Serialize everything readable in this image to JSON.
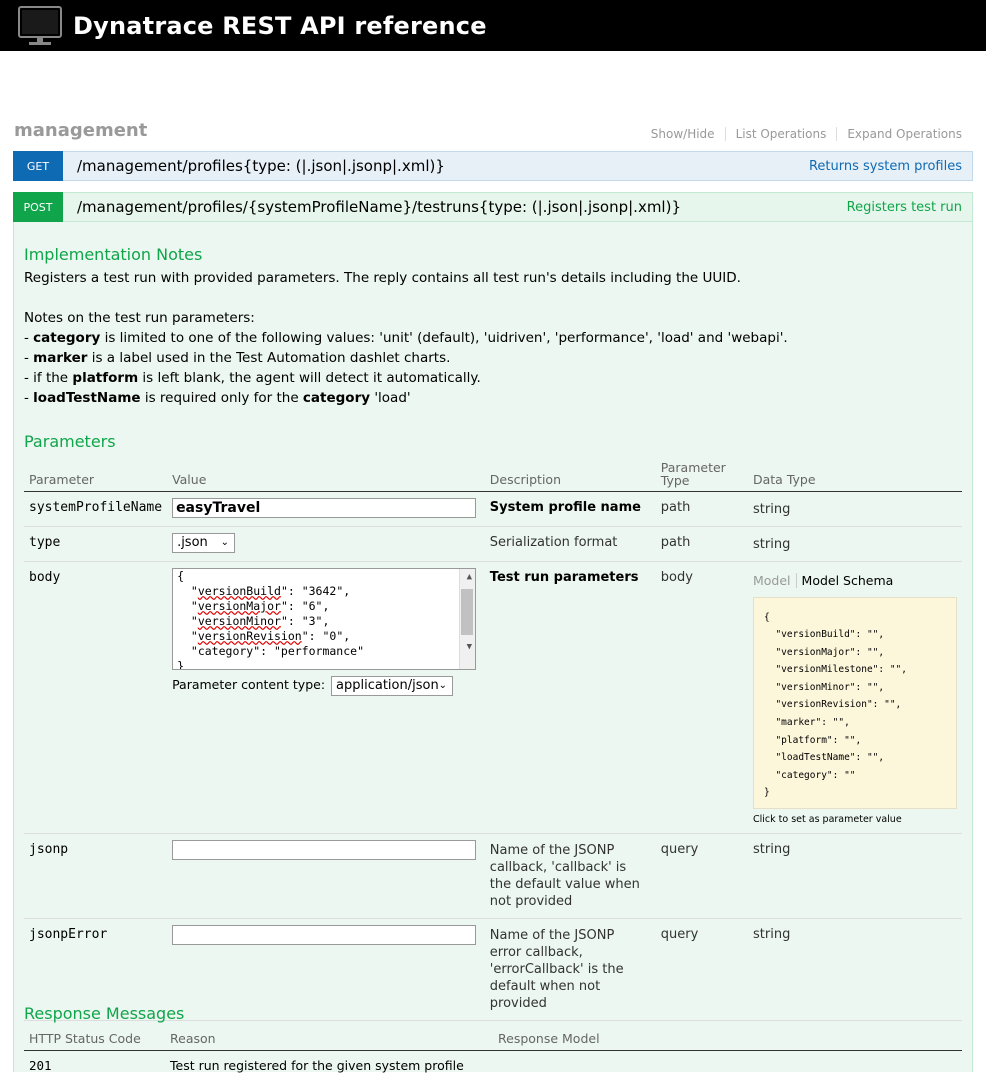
{
  "app": {
    "title": "Dynatrace REST API reference"
  },
  "section": {
    "name": "management",
    "links": [
      "Show/Hide",
      "List Operations",
      "Expand Operations"
    ]
  },
  "ops": {
    "get": {
      "method": "GET",
      "path": "/management/profiles{type: (|.json|.jsonp|.xml)}",
      "summary": "Returns system profiles"
    },
    "post": {
      "method": "POST",
      "path": "/management/profiles/{systemProfileName}/testruns{type: (|.json|.jsonp|.xml)}",
      "summary": "Registers test run"
    }
  },
  "impl": {
    "heading": "Implementation Notes",
    "line1": "Registers a test run with provided parameters. The reply contains all test run's details including the UUID.",
    "notes_title": "Notes on the test run parameters:",
    "n1_dash": "- ",
    "n1_bold": "category",
    "n1_rest": " is limited to one of the following values: 'unit' (default), 'uidriven', 'performance', 'load' and 'webapi'.",
    "n2_dash": "- ",
    "n2_bold": "marker",
    "n2_rest": " is a label used in the Test Automation dashlet charts.",
    "n3_pre": "- if the ",
    "n3_bold": "platform",
    "n3_rest": " is left blank, the agent will detect it automatically.",
    "n4_dash": "- ",
    "n4_bold": "loadTestName",
    "n4_mid": " is required only for the ",
    "n4_bold2": "category",
    "n4_rest": " 'load'"
  },
  "params": {
    "heading": "Parameters",
    "headers": {
      "parameter": "Parameter",
      "value": "Value",
      "description": "Description",
      "ptype": "Parameter Type",
      "dtype": "Data Type"
    },
    "rows": {
      "spn": {
        "name": "systemProfileName",
        "value": "easyTravel",
        "desc": "System profile name",
        "ptype": "path",
        "dtype": "string"
      },
      "type": {
        "name": "type",
        "value": ".json",
        "desc": "Serialization format",
        "ptype": "path",
        "dtype": "string"
      },
      "body": {
        "name": "body",
        "desc": "Test run parameters",
        "ptype": "body",
        "lines": [
          "{",
          "  \"versionBuild\": \"3642\",",
          "  \"versionMajor\": \"6\",",
          "  \"versionMinor\": \"3\",",
          "  \"versionRevision\": \"0\",",
          "  \"category\": \"performance\"",
          "}"
        ],
        "content_type_label": "Parameter content type:",
        "content_type": "application/json",
        "model_tab": "Model",
        "schema_tab": "Model Schema",
        "schema": "{\n  \"versionBuild\": \"\",\n  \"versionMajor\": \"\",\n  \"versionMilestone\": \"\",\n  \"versionMinor\": \"\",\n  \"versionRevision\": \"\",\n  \"marker\": \"\",\n  \"platform\": \"\",\n  \"loadTestName\": \"\",\n  \"category\": \"\"\n}",
        "hint": "Click to set as parameter value"
      },
      "jsonp": {
        "name": "jsonp",
        "value": "",
        "desc": "Name of the JSONP callback, 'callback' is the default value when not provided",
        "ptype": "query",
        "dtype": "string"
      },
      "jsonpError": {
        "name": "jsonpError",
        "value": "",
        "desc": "Name of the JSONP error callback, 'errorCallback' is the default when not provided",
        "ptype": "query",
        "dtype": "string"
      }
    }
  },
  "responses": {
    "heading": "Response Messages",
    "headers": {
      "code": "HTTP Status Code",
      "reason": "Reason",
      "model": "Response Model"
    },
    "rows": [
      {
        "code": "201",
        "reason": "Test run registered for the given system profile",
        "model": ""
      }
    ]
  }
}
